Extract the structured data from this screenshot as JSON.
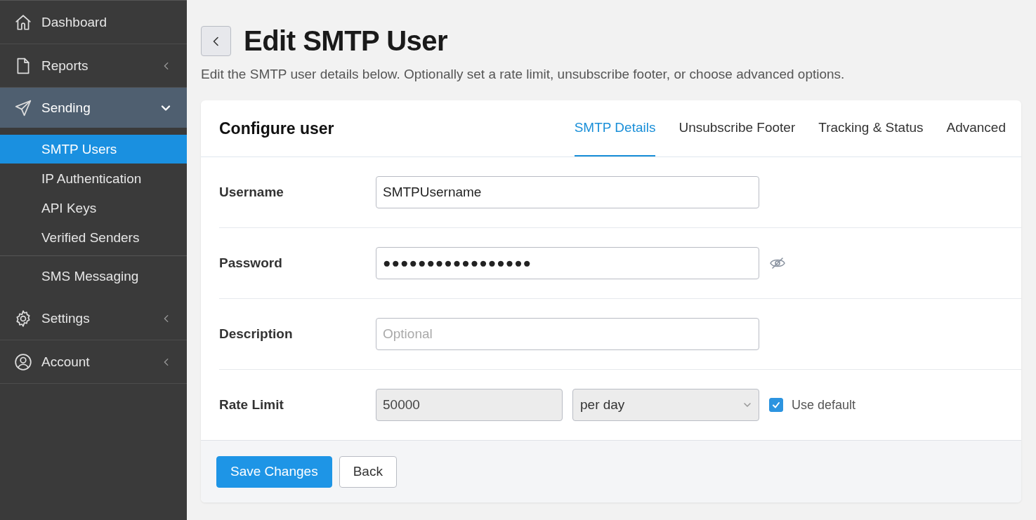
{
  "sidebar": {
    "items": [
      {
        "label": "Dashboard",
        "selected": false
      },
      {
        "label": "Reports",
        "selected": false,
        "expanded": false
      },
      {
        "label": "Sending",
        "selected": false,
        "expanded": true,
        "children": [
          {
            "label": "SMTP Users",
            "selected": true
          },
          {
            "label": "IP Authentication",
            "selected": false
          },
          {
            "label": "API Keys",
            "selected": false
          },
          {
            "label": "Verified Senders",
            "selected": false
          }
        ]
      },
      {
        "label": "SMS Messaging",
        "selected": false
      },
      {
        "label": "Settings",
        "selected": false,
        "expanded": false
      },
      {
        "label": "Account",
        "selected": false,
        "expanded": false
      }
    ]
  },
  "page": {
    "title": "Edit SMTP User",
    "subtitle": "Edit the SMTP user details below. Optionally set a rate limit, unsubscribe footer, or choose advanced options."
  },
  "card": {
    "title": "Configure user",
    "tabs": [
      {
        "label": "SMTP Details",
        "selected": true
      },
      {
        "label": "Unsubscribe Footer",
        "selected": false
      },
      {
        "label": "Tracking & Status",
        "selected": false
      },
      {
        "label": "Advanced",
        "selected": false
      }
    ],
    "fields": [
      {
        "kind": "text",
        "label": "Username",
        "value": "SMTPUsername"
      },
      {
        "kind": "password",
        "label": "Password",
        "value": "●●●●●●●●●●●●●●●●●",
        "revealed": false
      },
      {
        "kind": "text",
        "label": "Description",
        "placeholder": "Optional"
      },
      {
        "kind": "rate",
        "label": "Rate Limit",
        "value": "50000",
        "disabled": true,
        "period": "per day",
        "checkbox": {
          "label": "Use default",
          "checked": true
        }
      }
    ],
    "buttons": [
      {
        "label": "Save Changes",
        "kind": "primary"
      },
      {
        "label": "Back",
        "kind": "secondary"
      }
    ]
  }
}
